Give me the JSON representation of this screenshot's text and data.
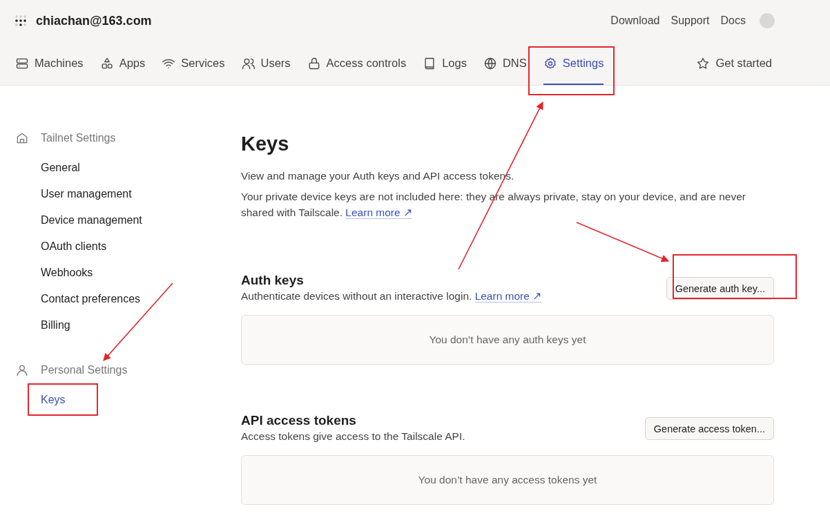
{
  "account": {
    "email": "chiachan@163.com"
  },
  "top_links": [
    "Download",
    "Support",
    "Docs"
  ],
  "nav_tabs": [
    {
      "label": "Machines",
      "selected": false
    },
    {
      "label": "Apps",
      "selected": false
    },
    {
      "label": "Services",
      "selected": false
    },
    {
      "label": "Users",
      "selected": false
    },
    {
      "label": "Access controls",
      "selected": false
    },
    {
      "label": "Logs",
      "selected": false
    },
    {
      "label": "DNS",
      "selected": false
    },
    {
      "label": "Settings",
      "selected": true
    }
  ],
  "get_started": "Get started",
  "sidebar": [
    {
      "heading": "Tailnet Settings",
      "items": [
        {
          "label": "General",
          "selected": false
        },
        {
          "label": "User management",
          "selected": false
        },
        {
          "label": "Device management",
          "selected": false
        },
        {
          "label": "OAuth clients",
          "selected": false
        },
        {
          "label": "Webhooks",
          "selected": false
        },
        {
          "label": "Contact preferences",
          "selected": false
        },
        {
          "label": "Billing",
          "selected": false
        }
      ]
    },
    {
      "heading": "Personal Settings",
      "items": [
        {
          "label": "Keys",
          "selected": true
        }
      ]
    }
  ],
  "page": {
    "title": "Keys",
    "intro": "View and manage your Auth keys and API access tokens.",
    "note": "Your private device keys are not included here: they are always private, stay on your device, and are never shared with Tailscale.",
    "note_link": "Learn more ↗"
  },
  "sections": [
    {
      "title": "Auth keys",
      "description": "Authenticate devices without an interactive login.",
      "link": "Learn more ↗",
      "button": "Generate auth key...",
      "empty": "You don’t have any auth keys yet"
    },
    {
      "title": "API access tokens",
      "description": "Access tokens give access to the Tailscale API.",
      "button": "Generate access token...",
      "empty": "You don’t have any access tokens yet"
    }
  ]
}
